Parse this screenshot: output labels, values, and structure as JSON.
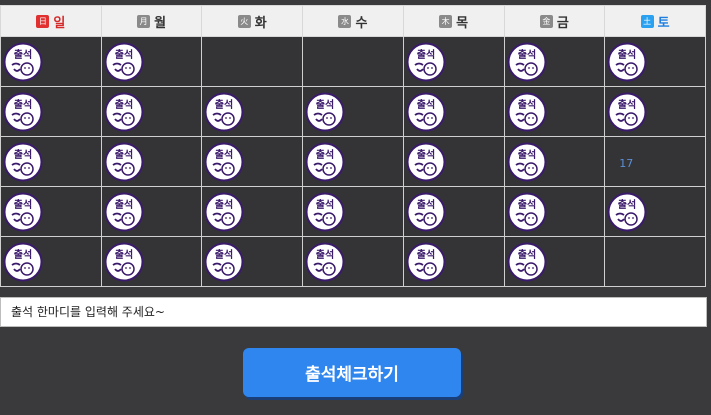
{
  "calendar": {
    "weekdays": [
      {
        "hanja": "日",
        "label": "일"
      },
      {
        "hanja": "月",
        "label": "월"
      },
      {
        "hanja": "火",
        "label": "화"
      },
      {
        "hanja": "水",
        "label": "수"
      },
      {
        "hanja": "木",
        "label": "목"
      },
      {
        "hanja": "金",
        "label": "금"
      },
      {
        "hanja": "土",
        "label": "토"
      }
    ],
    "stamp_text": "출석",
    "empty_day_label": "17",
    "weeks": [
      [
        true,
        true,
        false,
        false,
        true,
        true,
        true
      ],
      [
        true,
        true,
        true,
        true,
        true,
        true,
        true
      ],
      [
        true,
        true,
        true,
        true,
        true,
        true,
        false
      ],
      [
        true,
        true,
        true,
        true,
        true,
        true,
        true
      ],
      [
        true,
        true,
        true,
        true,
        true,
        true,
        null
      ]
    ]
  },
  "comment": {
    "placeholder": "출석 한마디를 입력해 주세요~"
  },
  "checkin_button": {
    "label": "출석체크하기"
  },
  "colors": {
    "sunday": "#d62a2a",
    "saturday": "#1f7fe0",
    "button": "#2f86ee",
    "background": "#3a3a3d"
  }
}
